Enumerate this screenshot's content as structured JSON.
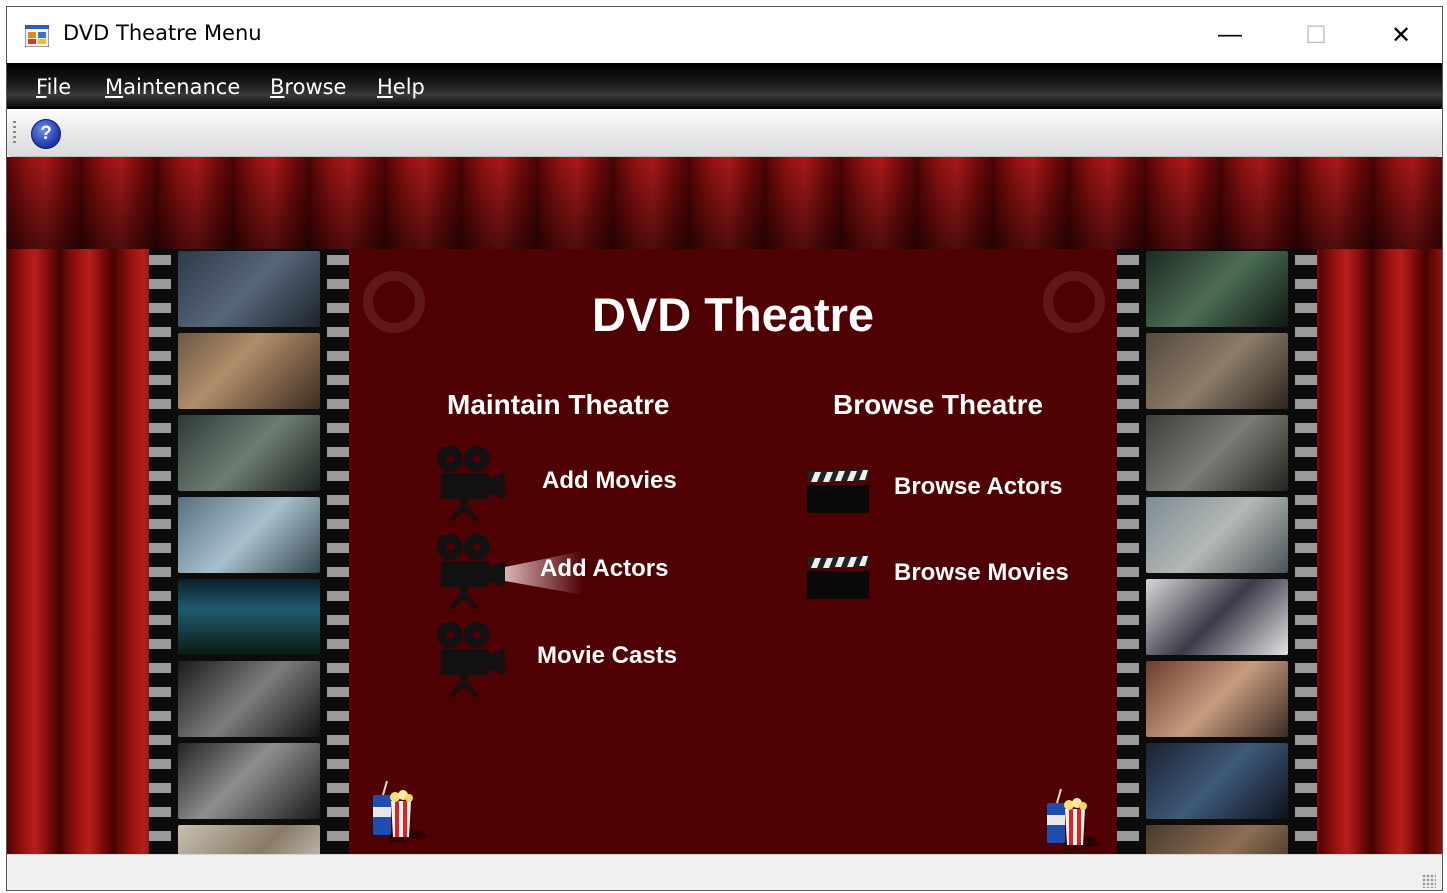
{
  "window": {
    "title": "DVD Theatre Menu",
    "controls": {
      "minimize": "—",
      "maximize": "☐",
      "close": "✕"
    }
  },
  "menubar": {
    "items": [
      {
        "label": "File",
        "accel": "F",
        "rest": "ile"
      },
      {
        "label": "Maintenance",
        "accel": "M",
        "rest": "aintenance"
      },
      {
        "label": "Browse",
        "accel": "B",
        "rest": "rowse"
      },
      {
        "label": "Help",
        "accel": "H",
        "rest": "elp"
      }
    ]
  },
  "toolbar": {
    "help_icon": "help-icon",
    "help_glyph": "?"
  },
  "theatre": {
    "title": "DVD Theatre",
    "maintain": {
      "heading": "Maintain Theatre",
      "items": [
        {
          "label": "Add Movies",
          "icon": "movie-camera-icon"
        },
        {
          "label": "Add Actors",
          "icon": "movie-camera-icon"
        },
        {
          "label": "Movie Casts",
          "icon": "movie-camera-icon"
        }
      ]
    },
    "browse": {
      "heading": "Browse Theatre",
      "items": [
        {
          "label": "Browse Actors",
          "icon": "clapperboard-icon"
        },
        {
          "label": "Browse Movies",
          "icon": "clapperboard-icon"
        }
      ]
    }
  },
  "colors": {
    "panel": "#4e0003",
    "curtain": "#9c1414",
    "menubar": "#000000",
    "text": "#ffffff"
  }
}
